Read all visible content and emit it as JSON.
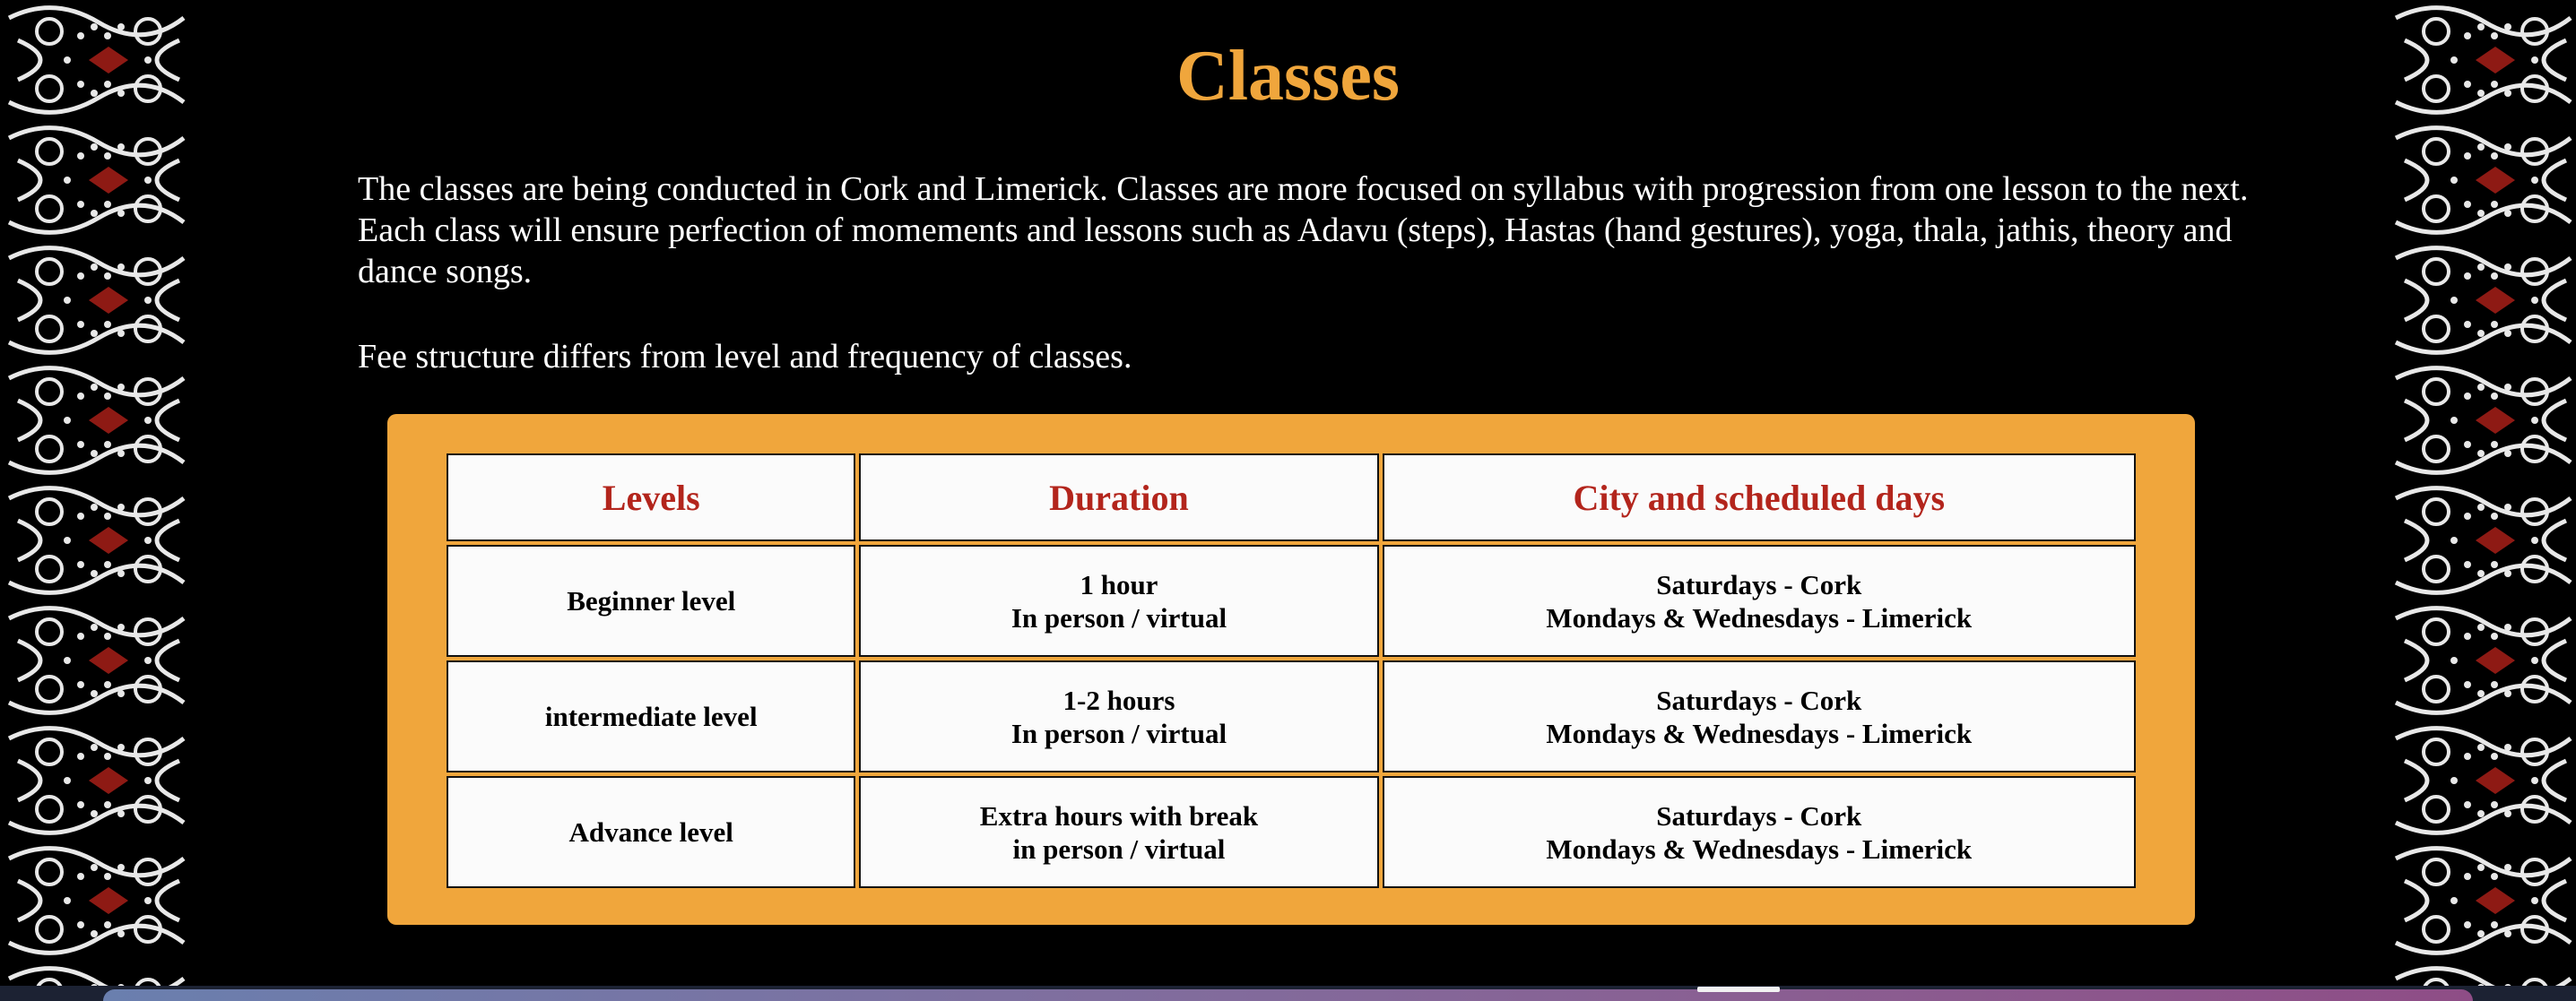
{
  "colors": {
    "background": "#000000",
    "accent_orange": "#F0A63C",
    "header_red": "#B3251C",
    "body_text": "#FFFFFF",
    "kolam_white": "#E8E8E8",
    "kolam_red": "#8E1A14"
  },
  "page": {
    "title": "Classes",
    "intro": "The classes are being conducted in Cork and Limerick. Classes are more focused on syllabus with progression from one lesson to the next. Each class will ensure perfection of momements and lessons such as Adavu (steps), Hastas (hand gestures), yoga, thala, jathis, theory and dance songs.",
    "fee_note": "Fee structure differs from level and frequency of classes."
  },
  "decor": {
    "left_border_icon": "kolam-pattern-icon",
    "right_border_icon": "kolam-pattern-icon"
  },
  "table": {
    "headers": [
      "Levels",
      "Duration",
      "City and scheduled days"
    ],
    "rows": [
      {
        "level": "Beginner level",
        "duration": [
          "1 hour",
          "In person / virtual"
        ],
        "city": [
          "Saturdays - Cork",
          "Mondays & Wednesdays - Limerick"
        ]
      },
      {
        "level": "intermediate level",
        "duration": [
          "1-2 hours",
          "In person / virtual"
        ],
        "city": [
          "Saturdays - Cork",
          "Mondays & Wednesdays - Limerick"
        ]
      },
      {
        "level": "Advance level",
        "duration": [
          "Extra hours with break",
          "in person / virtual"
        ],
        "city": [
          "Saturdays - Cork",
          "Mondays & Wednesdays - Limerick"
        ]
      }
    ]
  }
}
